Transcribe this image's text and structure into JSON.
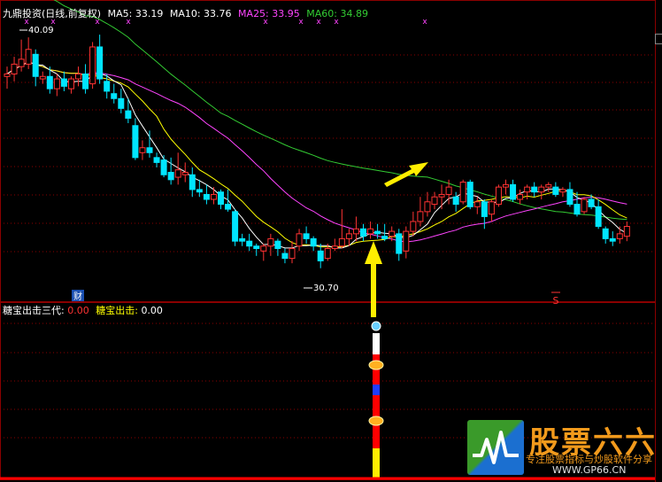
{
  "title": "九鼎投资(日线,前复权)",
  "ma_labels": [
    {
      "label": "MA5:",
      "value": "33.19",
      "color": "#ffffff"
    },
    {
      "label": "MA10:",
      "value": "33.76",
      "color": "#ffff00"
    },
    {
      "label": "MA25:",
      "value": "33.95",
      "color": "#ff44ff"
    },
    {
      "label": "MA60:",
      "value": "34.89",
      "color": "#33cc33"
    }
  ],
  "indicator": {
    "name": "糖宝出击三代",
    "value1": "0.00",
    "label2": "糖宝出击:",
    "value2": "0.00"
  },
  "annotations": {
    "high": "40.09",
    "low": "30.70",
    "cai_badge": "财",
    "s_mark": "S"
  },
  "watermark": {
    "title": "股票六六",
    "tagline": "专注股票指标与炒股软件分享",
    "url": "WWW.GP66.CN"
  },
  "colors": {
    "up": "#ff3333",
    "down": "#00e5ff",
    "ma5": "#ffffff",
    "ma10": "#ffff00",
    "ma25": "#ff44ff",
    "ma60": "#33cc33",
    "grid": "#8b0000",
    "arrow": "#ffee00"
  },
  "chart_data": {
    "type": "candlestick",
    "ylim": [
      29.5,
      40.6
    ],
    "candles": [
      [
        38.5,
        38.9,
        38.0,
        38.6
      ],
      [
        38.6,
        39.3,
        38.3,
        39.0
      ],
      [
        38.9,
        40.0,
        38.7,
        39.2
      ],
      [
        39.0,
        40.09,
        38.8,
        39.6
      ],
      [
        39.4,
        39.6,
        38.1,
        38.5
      ],
      [
        38.4,
        38.7,
        38.2,
        38.5
      ],
      [
        38.5,
        38.9,
        37.8,
        38.0
      ],
      [
        38.0,
        38.6,
        37.7,
        38.4
      ],
      [
        38.4,
        38.7,
        37.9,
        38.1
      ],
      [
        38.0,
        38.5,
        37.8,
        38.4
      ],
      [
        38.4,
        38.9,
        38.1,
        38.6
      ],
      [
        38.6,
        39.0,
        37.8,
        38.0
      ],
      [
        38.2,
        39.9,
        38.0,
        39.7
      ],
      [
        39.7,
        40.2,
        38.2,
        38.4
      ],
      [
        38.3,
        38.6,
        37.6,
        37.9
      ],
      [
        37.8,
        38.2,
        37.4,
        37.6
      ],
      [
        37.6,
        38.0,
        37.0,
        37.2
      ],
      [
        37.1,
        37.6,
        36.6,
        36.8
      ],
      [
        36.5,
        36.8,
        35.1,
        35.2
      ],
      [
        35.4,
        35.9,
        35.1,
        35.6
      ],
      [
        35.6,
        36.3,
        35.2,
        35.4
      ],
      [
        35.2,
        35.4,
        34.8,
        35.0
      ],
      [
        35.1,
        35.3,
        34.4,
        34.5
      ],
      [
        34.6,
        35.2,
        34.1,
        34.3
      ],
      [
        34.4,
        35.4,
        34.1,
        34.7
      ],
      [
        34.5,
        35.0,
        34.2,
        34.6
      ],
      [
        34.5,
        34.8,
        33.6,
        33.9
      ],
      [
        33.9,
        34.3,
        33.6,
        33.8
      ],
      [
        33.7,
        34.1,
        33.3,
        33.5
      ],
      [
        33.5,
        34.0,
        33.3,
        33.7
      ],
      [
        33.8,
        33.9,
        33.1,
        33.3
      ],
      [
        33.3,
        33.9,
        33.0,
        33.1
      ],
      [
        33.0,
        33.1,
        31.6,
        31.8
      ],
      [
        31.9,
        32.1,
        31.6,
        31.8
      ],
      [
        31.8,
        32.1,
        31.4,
        31.6
      ],
      [
        31.6,
        31.7,
        31.2,
        31.5
      ],
      [
        31.4,
        31.7,
        31.0,
        31.6
      ],
      [
        31.6,
        32.1,
        31.2,
        31.9
      ],
      [
        31.8,
        31.9,
        31.2,
        31.5
      ],
      [
        31.3,
        31.5,
        30.9,
        31.1
      ],
      [
        31.1,
        31.8,
        30.9,
        31.5
      ],
      [
        31.6,
        32.3,
        31.4,
        32.1
      ],
      [
        32.1,
        32.4,
        31.7,
        31.9
      ],
      [
        31.9,
        32.0,
        31.4,
        31.6
      ],
      [
        31.4,
        31.7,
        30.7,
        31.0
      ],
      [
        31.1,
        31.7,
        31.0,
        31.5
      ],
      [
        31.5,
        31.9,
        31.4,
        31.6
      ],
      [
        31.6,
        33.1,
        31.5,
        31.9
      ],
      [
        31.9,
        32.3,
        31.6,
        32.1
      ],
      [
        32.1,
        32.8,
        31.8,
        32.3
      ],
      [
        32.3,
        32.5,
        31.8,
        32.0
      ],
      [
        32.1,
        32.6,
        31.9,
        32.3
      ],
      [
        32.2,
        32.5,
        31.9,
        32.1
      ],
      [
        32.0,
        32.5,
        31.8,
        31.9
      ],
      [
        32.0,
        32.4,
        31.8,
        32.2
      ],
      [
        32.1,
        32.3,
        31.0,
        31.3
      ],
      [
        31.4,
        32.4,
        31.1,
        32.2
      ],
      [
        32.2,
        33.0,
        32.0,
        32.6
      ],
      [
        32.6,
        33.6,
        32.4,
        33.0
      ],
      [
        33.0,
        33.8,
        32.8,
        33.4
      ],
      [
        33.3,
        33.8,
        33.1,
        33.6
      ],
      [
        33.6,
        34.1,
        33.1,
        33.7
      ],
      [
        33.7,
        34.3,
        33.3,
        34.0
      ],
      [
        33.6,
        33.8,
        33.0,
        33.3
      ],
      [
        33.4,
        34.3,
        33.3,
        34.2
      ],
      [
        34.2,
        34.3,
        33.1,
        33.2
      ],
      [
        33.2,
        33.6,
        32.9,
        33.4
      ],
      [
        33.4,
        33.5,
        32.3,
        32.8
      ],
      [
        32.9,
        33.5,
        32.6,
        33.4
      ],
      [
        33.3,
        34.1,
        33.2,
        34.0
      ],
      [
        34.0,
        34.3,
        33.7,
        34.1
      ],
      [
        34.1,
        34.3,
        33.4,
        33.5
      ],
      [
        33.5,
        33.9,
        33.3,
        33.7
      ],
      [
        33.8,
        34.1,
        33.5,
        34.0
      ],
      [
        34.0,
        34.2,
        33.6,
        33.8
      ],
      [
        33.8,
        34.1,
        33.5,
        34.0
      ],
      [
        34.0,
        34.2,
        33.8,
        34.1
      ],
      [
        34.0,
        34.2,
        33.6,
        33.7
      ],
      [
        33.8,
        34.0,
        33.6,
        33.9
      ],
      [
        33.9,
        34.2,
        33.2,
        33.3
      ],
      [
        33.3,
        33.8,
        32.8,
        32.9
      ],
      [
        33.0,
        33.6,
        32.9,
        33.5
      ],
      [
        33.5,
        33.7,
        33.1,
        33.2
      ],
      [
        33.2,
        33.5,
        32.3,
        32.4
      ],
      [
        32.3,
        32.4,
        31.7,
        31.9
      ],
      [
        31.9,
        32.2,
        31.6,
        31.8
      ],
      [
        31.9,
        32.4,
        31.7,
        32.1
      ],
      [
        32.0,
        32.6,
        31.8,
        32.4
      ]
    ]
  }
}
